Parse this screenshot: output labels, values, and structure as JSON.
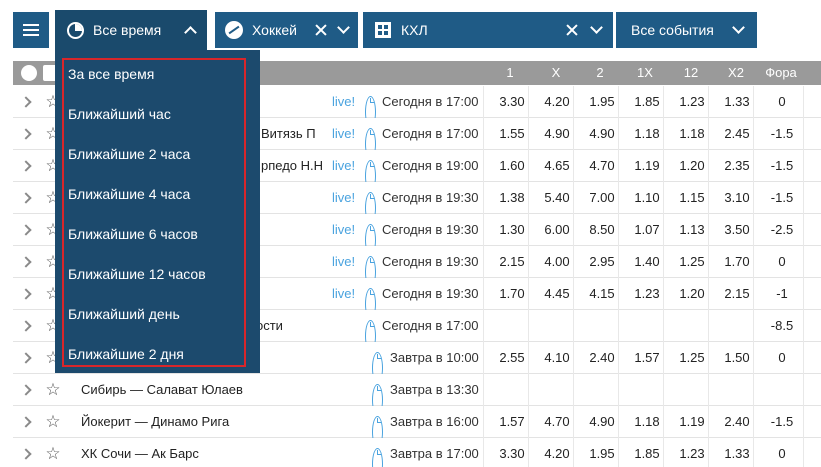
{
  "topbar": {
    "time_filter": "Все время",
    "sport_filter": "Хоккей",
    "league_filter": "КХЛ",
    "events_filter": "Все события"
  },
  "table_header": {
    "cols": [
      "1",
      "X",
      "2",
      "1X",
      "12",
      "X2",
      "Фора"
    ]
  },
  "dropdown": {
    "items": [
      "За все время",
      "Ближайший час",
      "Ближайшие 2 часа",
      "Ближайшие 4 часа",
      "Ближайшие 6 часов",
      "Ближайшие 12 часов",
      "Ближайший день",
      "Ближайшие 2 дня"
    ]
  },
  "rows": [
    {
      "teams": "",
      "live": "live!",
      "time": "Сегодня в 17:00",
      "odds": [
        "3.30",
        "4.20",
        "1.95",
        "1.85",
        "1.23",
        "1.33",
        "0"
      ]
    },
    {
      "teams": "Витязь П",
      "live": "live!",
      "time": "Сегодня в 17:00",
      "odds": [
        "1.55",
        "4.90",
        "4.90",
        "1.18",
        "1.18",
        "2.45",
        "-1.5"
      ]
    },
    {
      "teams": "рпедо Н.Н",
      "live": "live!",
      "time": "Сегодня в 19:00",
      "odds": [
        "1.60",
        "4.65",
        "4.70",
        "1.19",
        "1.20",
        "2.35",
        "-1.5"
      ]
    },
    {
      "teams": "",
      "live": "live!",
      "time": "Сегодня в 19:30",
      "odds": [
        "1.38",
        "5.40",
        "7.00",
        "1.10",
        "1.15",
        "3.10",
        "-1.5"
      ]
    },
    {
      "teams": "",
      "live": "live!",
      "time": "Сегодня в 19:30",
      "odds": [
        "1.30",
        "6.00",
        "8.50",
        "1.07",
        "1.13",
        "3.50",
        "-2.5"
      ]
    },
    {
      "teams": "",
      "live": "live!",
      "time": "Сегодня в 19:30",
      "odds": [
        "2.15",
        "4.00",
        "2.95",
        "1.40",
        "1.25",
        "1.70",
        "0"
      ]
    },
    {
      "teams": "",
      "live": "live!",
      "time": "Сегодня в 19:30",
      "odds": [
        "1.70",
        "4.45",
        "4.15",
        "1.23",
        "1.20",
        "2.15",
        "-1"
      ]
    },
    {
      "teams": "ости",
      "live": "",
      "time": "Сегодня в 17:00",
      "odds": [
        "",
        "",
        "",
        "",
        "",
        "",
        "-8.5"
      ]
    },
    {
      "teams": "",
      "live": "",
      "time": "Завтра в 10:00",
      "odds": [
        "2.55",
        "4.10",
        "2.40",
        "1.57",
        "1.25",
        "1.50",
        "0"
      ]
    },
    {
      "teams": "Сибирь — Салават Юлаев",
      "live": "",
      "time": "Завтра в 13:30",
      "odds": [
        "",
        "",
        "",
        "",
        "",
        "",
        ""
      ]
    },
    {
      "teams": "Йокерит — Динамо Рига",
      "live": "",
      "time": "Завтра в 16:00",
      "odds": [
        "1.57",
        "4.70",
        "4.90",
        "1.18",
        "1.19",
        "2.40",
        "-1.5"
      ]
    },
    {
      "teams": "ХК Сочи — Ак Барс",
      "live": "",
      "time": "Завтра в 17:00",
      "odds": [
        "3.30",
        "4.20",
        "1.95",
        "1.85",
        "1.23",
        "1.33",
        "0"
      ]
    }
  ]
}
